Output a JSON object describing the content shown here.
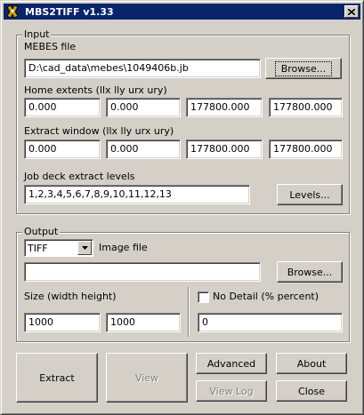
{
  "window": {
    "title": "MBS2TIFF v1.33"
  },
  "input": {
    "group_label": "Input",
    "mebes_label": "MEBES file",
    "mebes_value": "D:\\cad_data\\mebes\\1049406b.jb",
    "browse_label": "Browse...",
    "home_label": "Home extents (llx lly urx ury)",
    "home_values": [
      "0.000",
      "0.000",
      "177800.000",
      "177800.000"
    ],
    "extract_label": "Extract window (llx lly urx ury)",
    "extract_values": [
      "0.000",
      "0.000",
      "177800.000",
      "177800.000"
    ],
    "levels_label": "Job deck extract levels",
    "levels_value": "1,2,3,4,5,6,7,8,9,10,11,12,13",
    "levels_button": "Levels..."
  },
  "output": {
    "group_label": "Output",
    "format_value": "TIFF",
    "image_file_label": "Image file",
    "image_file_value": "",
    "browse_label": "Browse...",
    "size_label": "Size (width height)",
    "width_value": "1000",
    "height_value": "1000",
    "no_detail_label": "No Detail (% percent)",
    "no_detail_checked": false,
    "no_detail_value": "0"
  },
  "actions": {
    "extract": "Extract",
    "view": "View",
    "advanced": "Advanced",
    "about": "About",
    "view_log": "View Log",
    "close": "Close"
  }
}
